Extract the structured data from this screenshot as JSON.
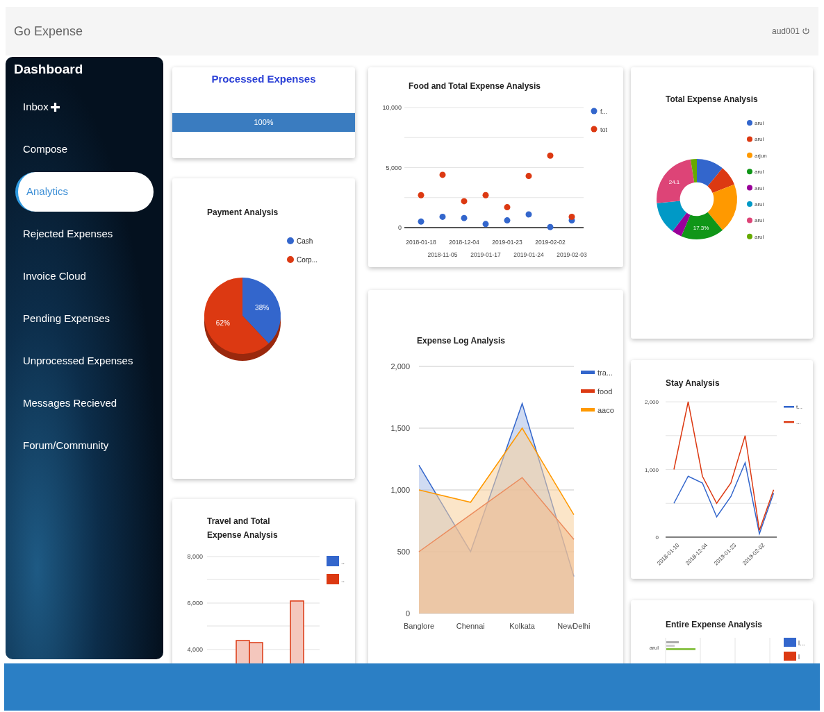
{
  "header": {
    "title": "Go Expense",
    "user": "aud001"
  },
  "sidebar": {
    "heading": "Dashboard",
    "items": [
      {
        "label": "Inbox",
        "kind": "add",
        "selected": false
      },
      {
        "label": "Compose",
        "kind": "plain",
        "selected": false
      },
      {
        "label": "Analytics",
        "kind": "plain",
        "selected": true
      },
      {
        "label": "Rejected Expenses",
        "kind": "plain",
        "selected": false
      },
      {
        "label": "Invoice Cloud",
        "kind": "plain",
        "selected": false
      },
      {
        "label": "Pending Expenses",
        "kind": "plain",
        "selected": false
      },
      {
        "label": "Unprocessed Expenses",
        "kind": "plain",
        "selected": false
      },
      {
        "label": "Messages Recieved",
        "kind": "plain",
        "selected": false
      },
      {
        "label": "Forum/Community",
        "kind": "plain",
        "selected": false
      }
    ]
  },
  "processed": {
    "title": "Processed Expenses",
    "progress": {
      "level": 1,
      "label": "100%"
    }
  },
  "payment": {
    "slices": [
      {
        "color": "#3366cc"
      },
      {
        "color": "#dc3912"
      }
    ],
    "chart_data": {
      "type": "pie",
      "title": "Payment Analysis",
      "legend": "right",
      "categories": [
        "Cash",
        "Corp..."
      ],
      "values": [
        38,
        62
      ],
      "value_labels": [
        "38%",
        "62%"
      ]
    }
  },
  "travel": {
    "title": "Travel and Total Expense Analysis",
    "axis_labels": [
      "8,000",
      "6,000",
      "4,000"
    ],
    "legend": [
      {
        "label": "..",
        "color": "#3366cc"
      },
      {
        "label": "..",
        "color": "#dc3912"
      }
    ]
  },
  "food": {
    "chart_data": {
      "type": "scatter",
      "title": "Food and Total Expense Analysis",
      "legend": "right",
      "categories": [
        "2018-01-18",
        "2018-11-05",
        "2018-12-04",
        "2019-01-17",
        "2019-01-23",
        "2019-01-24",
        "2019-02-02",
        "2019-02-03"
      ],
      "ylim": [
        0,
        10000
      ],
      "yticks": [
        {
          "value": 0,
          "label": "0"
        },
        {
          "value": 5000,
          "label": "5,000"
        },
        {
          "value": 10000,
          "label": "10,000"
        }
      ],
      "series": [
        {
          "name": "f...",
          "color": "#3366cc",
          "values": [
            500,
            900,
            800,
            300,
            600,
            1100,
            50,
            600
          ]
        },
        {
          "name": "tot",
          "color": "#dc3912",
          "values": [
            2700,
            4400,
            2200,
            2700,
            1700,
            4300,
            6000,
            900
          ]
        }
      ]
    }
  },
  "expense_log": {
    "chart_data": {
      "type": "area",
      "title": "Expense Log Analysis",
      "legend": "right",
      "grid": true,
      "categories": [
        "Banglore",
        "Chennai",
        "Kolkata",
        "NewDelhi"
      ],
      "ylim": [
        0,
        2000
      ],
      "yticks": [
        {
          "value": 0,
          "label": "0"
        },
        {
          "value": 500,
          "label": "500"
        },
        {
          "value": 1000,
          "label": "1,000"
        },
        {
          "value": 1500,
          "label": "1,500"
        },
        {
          "value": 2000,
          "label": "2,000"
        }
      ],
      "series": [
        {
          "name": "tra...",
          "color": "#3366cc",
          "values": [
            1200,
            500,
            1700,
            300
          ]
        },
        {
          "name": "food",
          "color": "#dc3912",
          "values": [
            500,
            800,
            1100,
            600
          ]
        },
        {
          "name": "aaco",
          "color": "#ff9900",
          "values": [
            1000,
            900,
            1500,
            800
          ]
        }
      ]
    }
  },
  "total": {
    "slices": [
      {
        "color": "#3366cc"
      },
      {
        "color": "#dc3912"
      },
      {
        "color": "#ff9900"
      },
      {
        "color": "#109618"
      },
      {
        "color": "#990099"
      },
      {
        "color": "#0099c6"
      },
      {
        "color": "#dd4477"
      },
      {
        "color": "#66aa00"
      }
    ],
    "chart_data": {
      "type": "donut",
      "title": "Total Expense Analysis",
      "legend": "right",
      "categories": [
        "arul",
        "arul",
        "arjun",
        "arul",
        "arul",
        "arul",
        "arul",
        "arul"
      ],
      "values": [
        11,
        8,
        20,
        17.3,
        4,
        13.1,
        24.1,
        2.5
      ],
      "value_labels": [
        null,
        null,
        null,
        "17.3%",
        null,
        null,
        "24.1",
        null
      ]
    }
  },
  "stay": {
    "chart_data": {
      "type": "line",
      "title": "Stay Analysis",
      "legend": "right",
      "grid": true,
      "categories": [
        "2018-01-10",
        null,
        "2018-12-04",
        null,
        "2019-01-23",
        null,
        "2019-02-02",
        null
      ],
      "ylim": [
        0,
        2000
      ],
      "yticks": [
        {
          "value": 0,
          "label": "0"
        },
        {
          "value": 1000,
          "label": "1,000"
        },
        {
          "value": 2000,
          "label": "2,000"
        }
      ],
      "series": [
        {
          "name": "t...",
          "color": "#3366cc",
          "values": [
            500,
            900,
            800,
            300,
            600,
            1100,
            50,
            650
          ]
        },
        {
          "name": "...",
          "color": "#dc3912",
          "values": [
            1000,
            2000,
            900,
            500,
            800,
            1500,
            100,
            700
          ]
        }
      ]
    }
  },
  "entire": {
    "title": "Entire Expense Analysis",
    "axis_label": "arul",
    "legend": [
      {
        "label": "l...",
        "color": "#3366cc"
      },
      {
        "label": "l",
        "color": "#dc3912"
      }
    ]
  }
}
